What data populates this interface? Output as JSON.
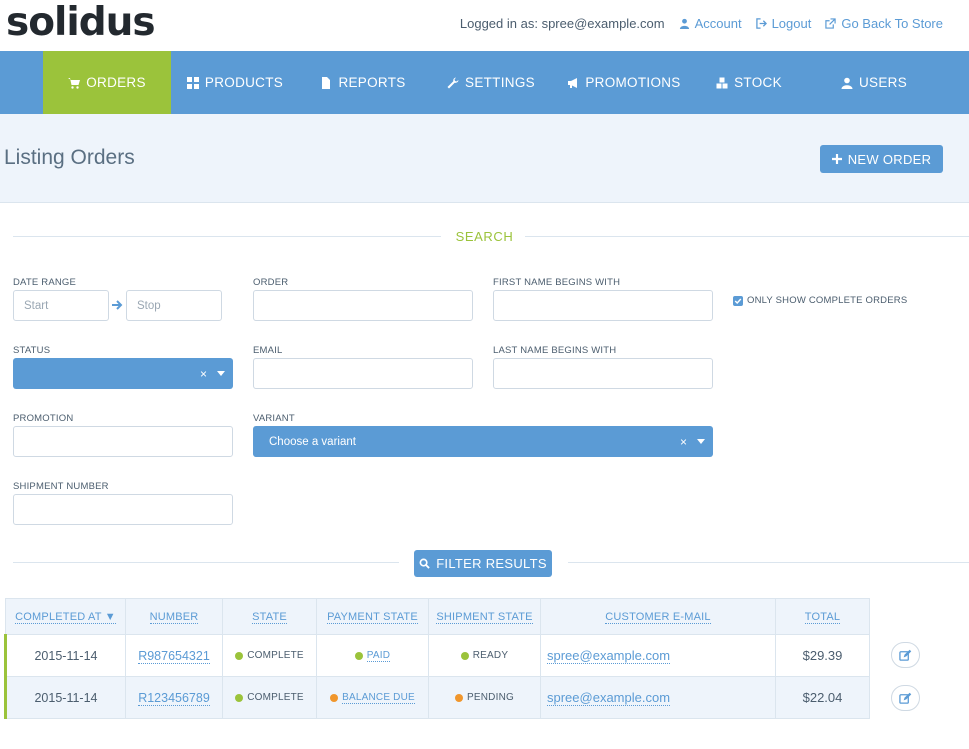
{
  "app": {
    "logo": "solidus"
  },
  "header": {
    "logged_in_text": "Logged in as: spree@example.com",
    "account": "Account",
    "logout": "Logout",
    "back_to_store": "Go Back To Store"
  },
  "nav": {
    "items": [
      {
        "label": "ORDERS",
        "icon": "cart-icon",
        "active": true
      },
      {
        "label": "PRODUCTS",
        "icon": "grid-icon"
      },
      {
        "label": "REPORTS",
        "icon": "file-icon"
      },
      {
        "label": "SETTINGS",
        "icon": "wrench-icon"
      },
      {
        "label": "PROMOTIONS",
        "icon": "bullhorn-icon"
      },
      {
        "label": "STOCK",
        "icon": "cubes-icon"
      },
      {
        "label": "USERS",
        "icon": "user-icon"
      }
    ]
  },
  "page": {
    "title": "Listing Orders",
    "new_order": "NEW ORDER"
  },
  "search": {
    "title": "SEARCH",
    "date_range_label": "DATE RANGE",
    "start_placeholder": "Start",
    "stop_placeholder": "Stop",
    "order_label": "ORDER",
    "first_name_label": "FIRST NAME BEGINS WITH",
    "only_complete_label": "ONLY SHOW COMPLETE ORDERS",
    "only_complete_checked": true,
    "status_label": "STATUS",
    "status_value": "",
    "email_label": "EMAIL",
    "last_name_label": "LAST NAME BEGINS WITH",
    "promotion_label": "PROMOTION",
    "variant_label": "VARIANT",
    "variant_placeholder": "Choose a variant",
    "shipment_label": "SHIPMENT NUMBER",
    "filter_button": "FILTER RESULTS",
    "clear_glyph": "×"
  },
  "table": {
    "headers": {
      "completed_at": "COMPLETED AT ▼",
      "number": "NUMBER",
      "state": "STATE",
      "payment_state": "PAYMENT STATE",
      "shipment_state": "SHIPMENT STATE",
      "email": "CUSTOMER E-MAIL",
      "total": "TOTAL"
    },
    "rows": [
      {
        "completed_at": "2015-11-14",
        "number": "R987654321",
        "state": "COMPLETE",
        "payment_state": "PAID",
        "shipment_state": "READY",
        "email": "spree@example.com",
        "total": "$29.39"
      },
      {
        "completed_at": "2015-11-14",
        "number": "R123456789",
        "state": "COMPLETE",
        "payment_state": "BALANCE DUE",
        "shipment_state": "PENDING",
        "email": "spree@example.com",
        "total": "$22.04"
      }
    ]
  },
  "colors": {
    "accent_blue": "#5b9bd5",
    "accent_green": "#9bc33b",
    "warning_orange": "#f0962c"
  }
}
